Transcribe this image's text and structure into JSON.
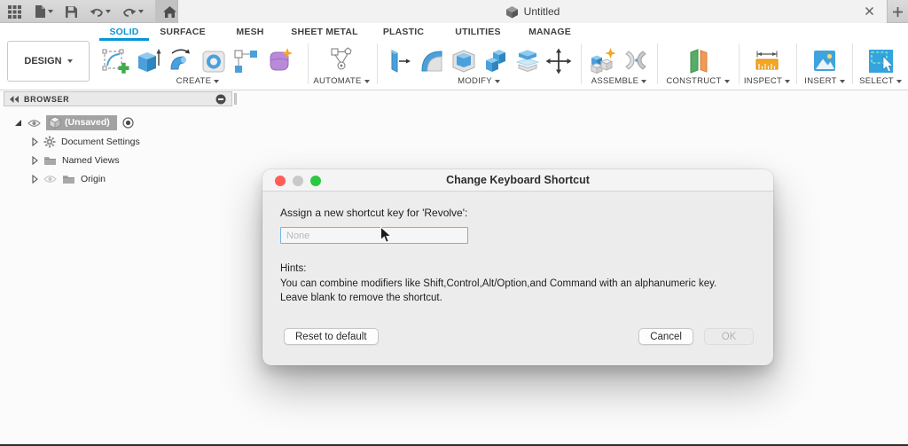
{
  "window": {
    "doc_title": "Untitled"
  },
  "ribbon": {
    "design_label": "DESIGN",
    "tabs": [
      {
        "label": "SOLID",
        "active": true
      },
      {
        "label": "SURFACE"
      },
      {
        "label": "MESH"
      },
      {
        "label": "SHEET METAL"
      },
      {
        "label": "PLASTIC"
      },
      {
        "label": "UTILITIES"
      },
      {
        "label": "MANAGE"
      }
    ],
    "groups": [
      {
        "label": "CREATE",
        "tools": [
          "create-sketch-icon",
          "extrude-icon",
          "revolve-icon",
          "hole-icon",
          "pattern-icon",
          "create-form-icon"
        ]
      },
      {
        "label": "AUTOMATE",
        "tools": [
          "automate-icon"
        ]
      },
      {
        "label": "MODIFY",
        "tools": [
          "press-pull-icon",
          "fillet-icon",
          "shell-icon",
          "combine-icon",
          "split-body-icon",
          "move-copy-icon"
        ]
      },
      {
        "label": "ASSEMBLE",
        "tools": [
          "new-component-icon",
          "joint-icon"
        ]
      },
      {
        "label": "CONSTRUCT",
        "tools": [
          "construct-plane-icon"
        ]
      },
      {
        "label": "INSPECT",
        "tools": [
          "measure-icon"
        ]
      },
      {
        "label": "INSERT",
        "tools": [
          "insert-image-icon"
        ]
      },
      {
        "label": "SELECT",
        "tools": [
          "select-icon"
        ]
      }
    ]
  },
  "browser": {
    "title": "BROWSER",
    "rows": [
      {
        "label": "(Unsaved)",
        "selected": true
      },
      {
        "label": "Document Settings"
      },
      {
        "label": "Named Views"
      },
      {
        "label": "Origin"
      }
    ]
  },
  "dialog": {
    "title": "Change Keyboard Shortcut",
    "prompt": "Assign a new shortcut key for 'Revolve':",
    "input": {
      "value": "",
      "placeholder": "None"
    },
    "hints_title": "Hints:",
    "hints": [
      "You can combine modifiers like Shift,Control,Alt/Option,and Command with an alphanumeric key.",
      "Leave blank to remove the shortcut."
    ],
    "buttons": {
      "reset": "Reset to default",
      "cancel": "Cancel",
      "ok": "OK"
    }
  },
  "colors": {
    "accent_blue": "#0696d7",
    "tool_blue": "#4ba0dc",
    "create_green": "#3dae49",
    "form_purple": "#b98ad8",
    "star_orange": "#f5a623",
    "construct_green": "#57ad63",
    "construct_orange": "#ef9a57",
    "traffic_red": "#ff5e57",
    "traffic_green": "#2bc840"
  }
}
